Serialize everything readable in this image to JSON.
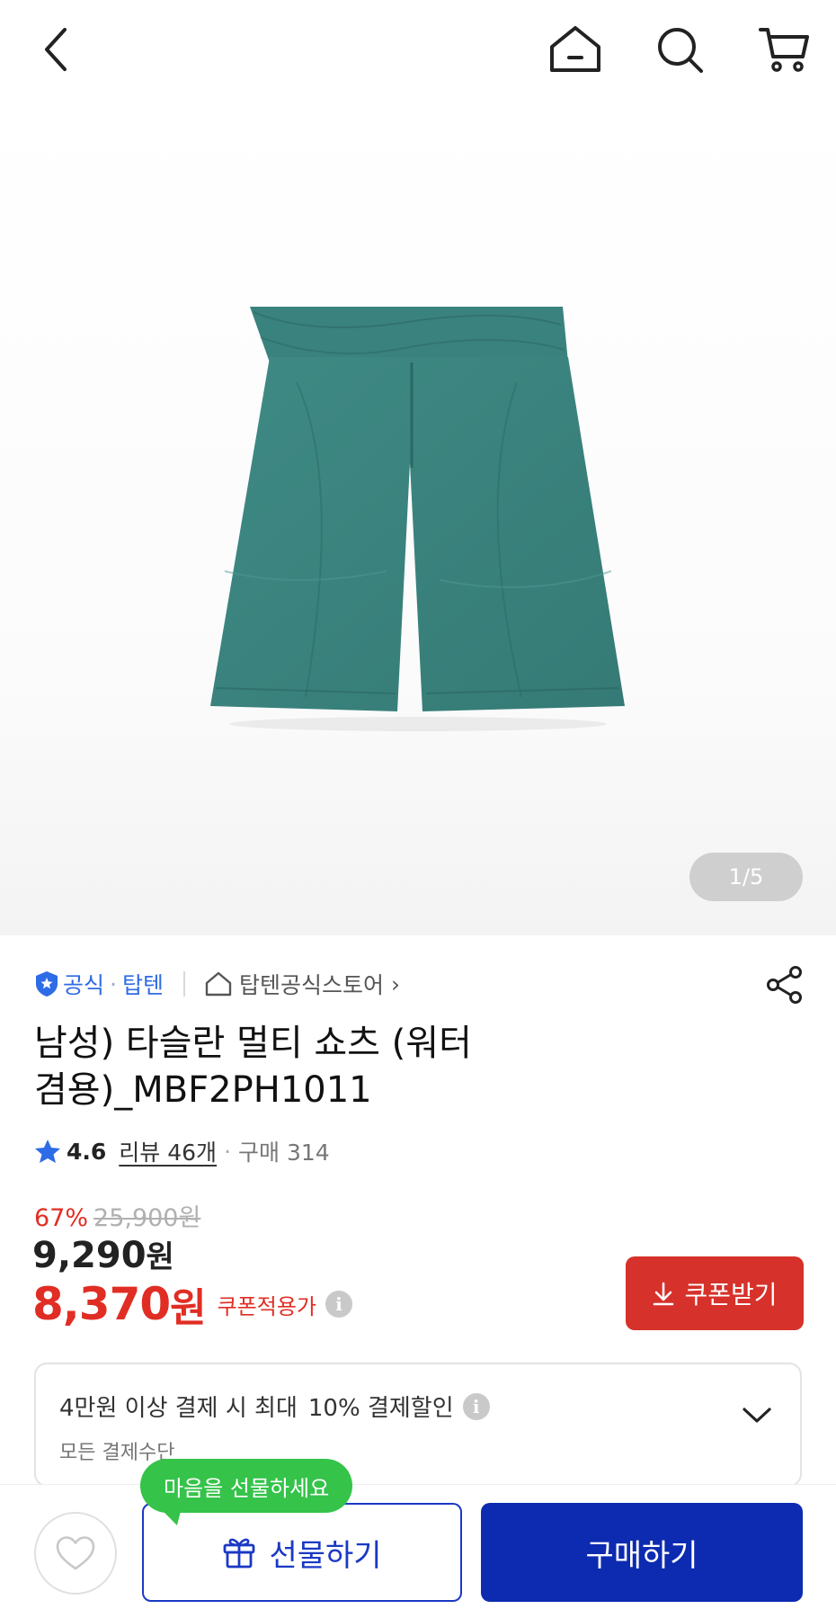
{
  "topbar": {
    "back_icon": "chevron-left-icon",
    "home_icon": "home-icon",
    "search_icon": "search-icon",
    "cart_icon": "cart-icon"
  },
  "hero": {
    "page_current": "1",
    "page_sep": "/",
    "page_total": "5",
    "product_color": "#3f8a85"
  },
  "store": {
    "official_label": "공식",
    "separator": "·",
    "brand": "탑텐",
    "store_name": "탑텐공식스토어",
    "store_chevron": "›"
  },
  "product": {
    "title": "남성) 타슬란 멀티 쇼츠 (워터 겸용)_MBF2PH1011"
  },
  "rating": {
    "score": "4.6",
    "reviews": "리뷰 46개",
    "dot": "·",
    "purchases": "구매 314"
  },
  "price": {
    "discount_rate": "67%",
    "original": "25,900원",
    "sale_value": "9,290",
    "sale_unit": "원",
    "coupon_value": "8,370",
    "coupon_unit": "원",
    "coupon_label": "쿠폰적용가",
    "info_glyph": "i"
  },
  "coupon_button": {
    "label": "쿠폰받기"
  },
  "payment": {
    "main_text": "4만원 이상 결제 시 최대",
    "pct_text": "10% 결제할인",
    "sub_text": "모든 결제수단",
    "info_glyph": "i"
  },
  "bottom": {
    "tooltip": "마음을 선물하세요",
    "gift_label": "선물하기",
    "buy_label": "구매하기"
  },
  "colors": {
    "accent_red": "#d6312a",
    "accent_blue": "#0d2bb0",
    "link_blue": "#2e6be6",
    "tooltip_green": "#35c34a"
  }
}
